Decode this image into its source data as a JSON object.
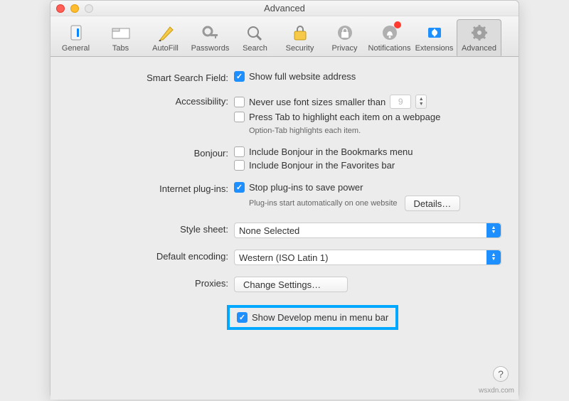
{
  "window": {
    "title": "Advanced"
  },
  "toolbar": {
    "items": [
      {
        "id": "general",
        "label": "General"
      },
      {
        "id": "tabs",
        "label": "Tabs"
      },
      {
        "id": "autofill",
        "label": "AutoFill"
      },
      {
        "id": "passwords",
        "label": "Passwords"
      },
      {
        "id": "search",
        "label": "Search"
      },
      {
        "id": "security",
        "label": "Security"
      },
      {
        "id": "privacy",
        "label": "Privacy"
      },
      {
        "id": "notifications",
        "label": "Notifications"
      },
      {
        "id": "extensions",
        "label": "Extensions"
      },
      {
        "id": "advanced",
        "label": "Advanced"
      }
    ],
    "selected": "advanced"
  },
  "sections": {
    "smart_search": {
      "label": "Smart Search Field:",
      "show_full_address": {
        "checked": true,
        "label": "Show full website address"
      }
    },
    "accessibility": {
      "label": "Accessibility:",
      "min_font": {
        "checked": false,
        "label": "Never use font sizes smaller than",
        "value": "9"
      },
      "press_tab": {
        "checked": false,
        "label": "Press Tab to highlight each item on a webpage"
      },
      "hint": "Option-Tab highlights each item."
    },
    "bonjour": {
      "label": "Bonjour:",
      "bookmarks": {
        "checked": false,
        "label": "Include Bonjour in the Bookmarks menu"
      },
      "favorites": {
        "checked": false,
        "label": "Include Bonjour in the Favorites bar"
      }
    },
    "plugins": {
      "label": "Internet plug-ins:",
      "stop": {
        "checked": true,
        "label": "Stop plug-ins to save power"
      },
      "hint": "Plug-ins start automatically on one website",
      "details_btn": "Details…"
    },
    "stylesheet": {
      "label": "Style sheet:",
      "value": "None Selected"
    },
    "encoding": {
      "label": "Default encoding:",
      "value": "Western (ISO Latin 1)"
    },
    "proxies": {
      "label": "Proxies:",
      "btn": "Change Settings…"
    },
    "develop": {
      "checked": true,
      "label": "Show Develop menu in menu bar"
    }
  },
  "watermark": "wsxdn.com"
}
